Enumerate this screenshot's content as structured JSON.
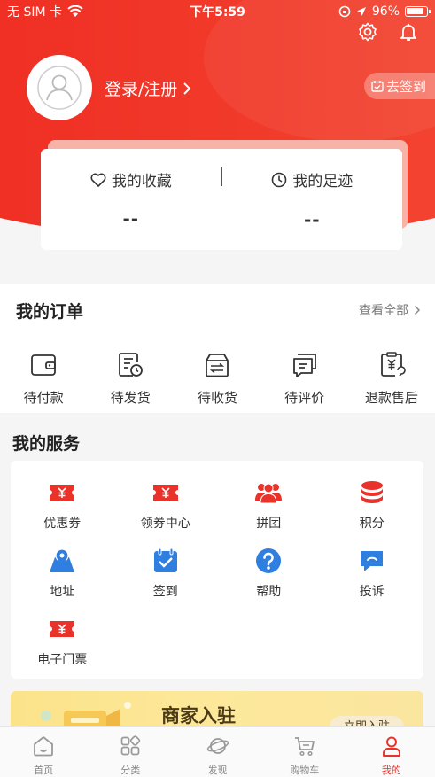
{
  "status_bar": {
    "carrier": "无 SIM 卡",
    "time": "下午5:59",
    "battery": "96%"
  },
  "header": {
    "login_label": "登录/注册",
    "checkin_label": "去签到"
  },
  "stats": {
    "favorites_label": "我的收藏",
    "favorites_value": "--",
    "footprints_label": "我的足迹",
    "footprints_value": "--"
  },
  "orders": {
    "title": "我的订单",
    "view_all": "查看全部",
    "items": [
      {
        "label": "待付款",
        "icon": "wallet-icon"
      },
      {
        "label": "待发货",
        "icon": "pending-shipment-icon"
      },
      {
        "label": "待收货",
        "icon": "receive-box-icon"
      },
      {
        "label": "待评价",
        "icon": "review-icon"
      },
      {
        "label": "退款售后",
        "icon": "refund-icon"
      }
    ]
  },
  "services": {
    "title": "我的服务",
    "items": [
      {
        "label": "优惠券",
        "icon": "coupon-icon"
      },
      {
        "label": "领券中心",
        "icon": "coupon-center-icon"
      },
      {
        "label": "拼团",
        "icon": "group-buy-icon"
      },
      {
        "label": "积分",
        "icon": "points-icon"
      },
      {
        "label": "地址",
        "icon": "address-icon"
      },
      {
        "label": "签到",
        "icon": "checkin-icon"
      },
      {
        "label": "帮助",
        "icon": "help-icon"
      },
      {
        "label": "投诉",
        "icon": "complaint-icon"
      },
      {
        "label": "电子门票",
        "icon": "e-ticket-icon"
      }
    ]
  },
  "banner": {
    "title": "商家入驻",
    "button": "立即入驻"
  },
  "tabbar": {
    "items": [
      {
        "label": "首页",
        "icon": "home-icon"
      },
      {
        "label": "分类",
        "icon": "category-icon"
      },
      {
        "label": "发现",
        "icon": "discover-icon"
      },
      {
        "label": "购物车",
        "icon": "cart-icon"
      },
      {
        "label": "我的",
        "icon": "profile-icon"
      }
    ],
    "active_index": 4
  },
  "colors": {
    "brand_red": "#ef2b22",
    "service_blue": "#2e7fe0",
    "active_tab": "#e8322a"
  }
}
